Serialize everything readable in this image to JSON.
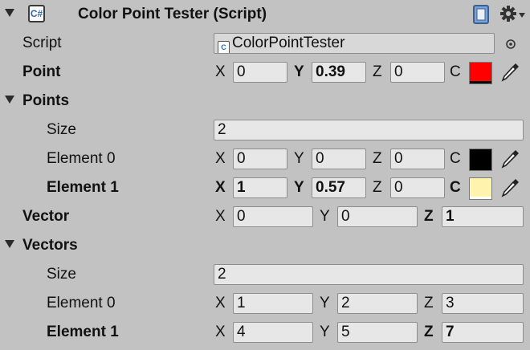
{
  "header": {
    "title": "Color Point Tester (Script)",
    "script_icon_text": "C#"
  },
  "script_row": {
    "label": "Script",
    "value": "ColorPointTester"
  },
  "point": {
    "label": "Point",
    "x_label": "X",
    "x": "0",
    "y_label": "Y",
    "y": "0.39",
    "z_label": "Z",
    "z": "0",
    "c_label": "C",
    "color": "#ff0000"
  },
  "points": {
    "label": "Points",
    "size_label": "Size",
    "size": "2",
    "element0": {
      "label": "Element 0",
      "x_label": "X",
      "x": "0",
      "y_label": "Y",
      "y": "0",
      "z_label": "Z",
      "z": "0",
      "c_label": "C",
      "color": "#000000"
    },
    "element1": {
      "label": "Element 1",
      "x_label": "X",
      "x": "1",
      "y_label": "Y",
      "y": "0.57",
      "z_label": "Z",
      "z": "0",
      "c_label": "C",
      "color": "#fff3ad"
    }
  },
  "vector": {
    "label": "Vector",
    "x_label": "X",
    "x": "0",
    "y_label": "Y",
    "y": "0",
    "z_label": "Z",
    "z": "1"
  },
  "vectors": {
    "label": "Vectors",
    "size_label": "Size",
    "size": "2",
    "element0": {
      "label": "Element 0",
      "x_label": "X",
      "x": "1",
      "y_label": "Y",
      "y": "2",
      "z_label": "Z",
      "z": "3"
    },
    "element1": {
      "label": "Element 1",
      "x_label": "X",
      "x": "4",
      "y_label": "Y",
      "y": "5",
      "z_label": "Z",
      "z": "7"
    }
  },
  "icons": [
    "foldout-arrow-icon",
    "script-icon",
    "help-book-icon",
    "gear-icon",
    "object-picker-icon",
    "eyedropper-icon"
  ]
}
